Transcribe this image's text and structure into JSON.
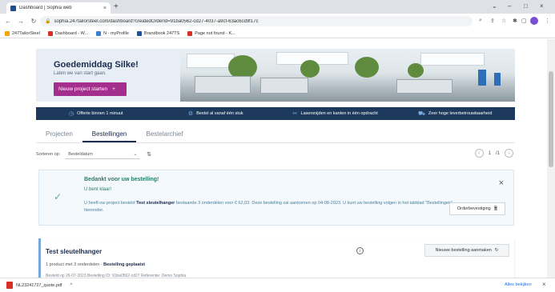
{
  "browser": {
    "tab_title": "Dashboard | Sophia web",
    "tab_close": "×",
    "new_tab": "+",
    "url": "sophia.247tailorsteel.com/dashboard?createdOrderId=91ba0562-cd27-4037-a9cf-63ac6cd9f17c",
    "controls": [
      "⌄",
      "–",
      "□",
      "×"
    ],
    "bookmarks": [
      {
        "label": "247TailorSteel",
        "color": "#f4a300"
      },
      {
        "label": "Dashboard - W...",
        "color": "#d93025"
      },
      {
        "label": "N - myProfile",
        "color": "#3b7dd8"
      },
      {
        "label": "Brandbook 247TS",
        "color": "#1d4e9b"
      },
      {
        "label": "Page not found - K...",
        "color": "#d93025"
      }
    ]
  },
  "hero": {
    "greeting": "Goedemiddag Silke!",
    "subgreeting": "Laten we van start gaan.",
    "start_button": "Nieuw project starten",
    "start_button_icon": "+"
  },
  "usps": [
    {
      "label": "Offerte binnen 1 minuut",
      "icon": "clock-icon"
    },
    {
      "label": "Bestel al vanaf één stuk",
      "icon": "parts-icon"
    },
    {
      "label": "Lasersnijden en kanten in één opdracht",
      "icon": "laser-icon"
    },
    {
      "label": "Zeer hoge leverbetrouwbaarheid",
      "icon": "truck-icon"
    }
  ],
  "tabs": [
    "Projecten",
    "Bestellingen",
    "Bestelarchief"
  ],
  "active_tab": "Bestellingen",
  "sort": {
    "label": "Sorteren op:",
    "value": "Besteldatum",
    "chevron": "⌄",
    "direction_icon": "⇅"
  },
  "pager": {
    "current": "1",
    "total": "/1",
    "prev": "‹",
    "next": "›"
  },
  "confirmation": {
    "title": "Bedankt voor uw bestelling!",
    "subtitle": "U bent klaar!",
    "text_prefix": "U heeft uw project besteld",
    "project_name": "Test sleutelhanger",
    "text_suffix": "bestaande 3 onderdelen voor € 62,03. Deze bestelling zal aankomen op 04-08-2023. U kunt uw bestelling volgen in het tabblad \"Bestellingen\" hieronder.",
    "button": "Orderbevestiging",
    "close": "×",
    "check": "✓"
  },
  "order": {
    "title": "Test sleutelhanger",
    "info": "i",
    "new_order_button": "Nieuwe bestelling aanmaken",
    "new_order_icon": "↻",
    "summary_prefix": "1 product met 3 onderdelen · ",
    "summary_status": "Bestelling geplaatst",
    "meta": "Besteld op 26-07-2023     Bestelling ID: 91ba0562-cd27     Referentie: Demo Sophia"
  },
  "downloads": {
    "file": "NL23241727_quote.pdf",
    "chevron": "^",
    "show_all": "Alles bekijken",
    "close": "×"
  }
}
